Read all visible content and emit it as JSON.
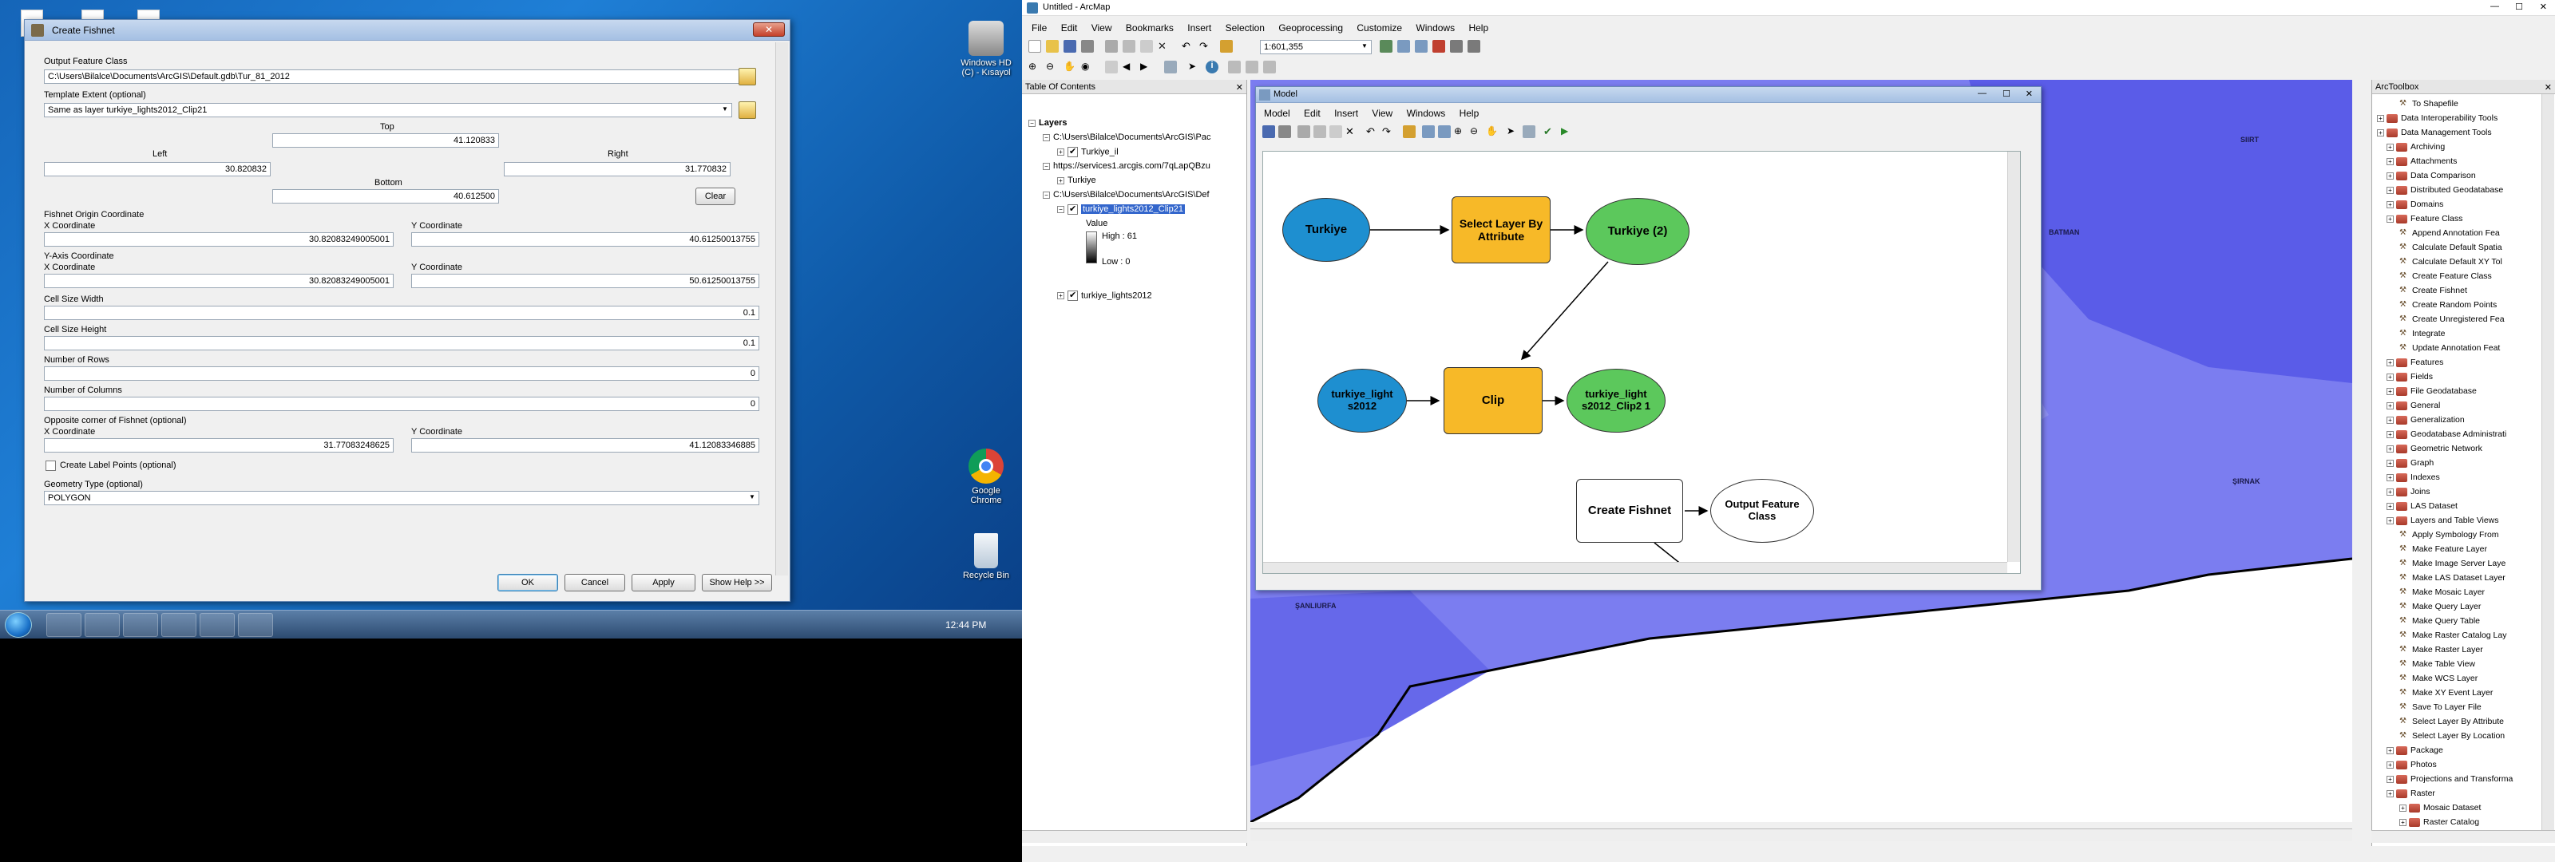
{
  "desktop": {
    "icons": [
      {
        "label": "Windows HD\n(C) - Kısayol"
      },
      {
        "label": "Google\nChrome"
      },
      {
        "label": "Recycle Bin"
      }
    ],
    "clock": "12:44 PM"
  },
  "dialog": {
    "title": "Create Fishnet",
    "output_label": "Output Feature Class",
    "output_value": "C:\\Users\\Bilalce\\Documents\\ArcGIS\\Default.gdb\\Tur_81_2012",
    "template_label": "Template Extent (optional)",
    "template_value": "Same as layer turkiye_lights2012_Clip21",
    "top_label": "Top",
    "top_value": "41.120833",
    "left_label": "Left",
    "left_value": "30.820832",
    "right_label": "Right",
    "right_value": "31.770832",
    "bottom_label": "Bottom",
    "bottom_value": "40.612500",
    "clear_label": "Clear",
    "origin_label": "Fishnet Origin Coordinate",
    "x_label": "X Coordinate",
    "y_label": "Y Coordinate",
    "origin_x": "30.82083249005001",
    "origin_y": "40.61250013755",
    "yaxis_label": "Y-Axis Coordinate",
    "yaxis_x": "30.82083249005001",
    "yaxis_y": "50.61250013755",
    "cellw_label": "Cell Size Width",
    "cellw_value": "0.1",
    "cellh_label": "Cell Size Height",
    "cellh_value": "0.1",
    "rows_label": "Number of Rows",
    "rows_value": "0",
    "cols_label": "Number of Columns",
    "cols_value": "0",
    "opposite_label": "Opposite corner of Fishnet (optional)",
    "opp_x": "31.77083248625",
    "opp_y": "41.12083346885",
    "labelpts_label": "Create Label Points (optional)",
    "geom_label": "Geometry Type (optional)",
    "geom_value": "POLYGON",
    "ok": "OK",
    "cancel": "Cancel",
    "apply": "Apply",
    "help": "Show Help >>"
  },
  "arcmap": {
    "title": "Untitled - ArcMap",
    "menus": [
      "File",
      "Edit",
      "View",
      "Bookmarks",
      "Insert",
      "Selection",
      "Geoprocessing",
      "Customize",
      "Windows",
      "Help"
    ],
    "scale": "1:601,355",
    "toc_title": "Table Of Contents",
    "toc": [
      "Layers",
      "C:\\Users\\Bilalce\\Documents\\ArcGIS\\Pac",
      "Turkiye_il",
      "https://services1.arcgis.com/7qLapQBzu",
      "Turkiye",
      "C:\\Users\\Bilalce\\Documents\\ArcGIS\\Def",
      "turkiye_lights2012_Clip21",
      "Value",
      "High : 61",
      "Low : 0",
      "turkiye_lights2012"
    ],
    "map_labels": [
      "SIIRT",
      "BATMAN",
      "ŞIRNAK",
      "ŞANLIURFA"
    ]
  },
  "model": {
    "title": "Model",
    "menus": [
      "Model",
      "Edit",
      "Insert",
      "View",
      "Windows",
      "Help"
    ],
    "nodes": {
      "turkiye": "Turkiye",
      "select": "Select Layer By Attribute",
      "turkiye2": "Turkiye (2)",
      "lights": "turkiye_light s2012",
      "clip": "Clip",
      "clipout": "turkiye_light s2012_Clip2 1",
      "fishnet": "Create Fishnet",
      "output": "Output Feature Class"
    }
  },
  "toolbox": {
    "title": "ArcToolbox",
    "items": [
      {
        "t": "To Shapefile",
        "lvl": 3,
        "k": "tool"
      },
      {
        "t": "Data Interoperability Tools",
        "lvl": 1,
        "k": "box"
      },
      {
        "t": "Data Management Tools",
        "lvl": 1,
        "k": "box"
      },
      {
        "t": "Archiving",
        "lvl": 2,
        "k": "box"
      },
      {
        "t": "Attachments",
        "lvl": 2,
        "k": "box"
      },
      {
        "t": "Data Comparison",
        "lvl": 2,
        "k": "box"
      },
      {
        "t": "Distributed Geodatabase",
        "lvl": 2,
        "k": "box"
      },
      {
        "t": "Domains",
        "lvl": 2,
        "k": "box"
      },
      {
        "t": "Feature Class",
        "lvl": 2,
        "k": "box"
      },
      {
        "t": "Append Annotation Fea",
        "lvl": 3,
        "k": "tool"
      },
      {
        "t": "Calculate Default Spatia",
        "lvl": 3,
        "k": "tool"
      },
      {
        "t": "Calculate Default XY Tol",
        "lvl": 3,
        "k": "tool"
      },
      {
        "t": "Create Feature Class",
        "lvl": 3,
        "k": "tool"
      },
      {
        "t": "Create Fishnet",
        "lvl": 3,
        "k": "tool"
      },
      {
        "t": "Create Random Points",
        "lvl": 3,
        "k": "tool"
      },
      {
        "t": "Create Unregistered Fea",
        "lvl": 3,
        "k": "tool"
      },
      {
        "t": "Integrate",
        "lvl": 3,
        "k": "tool"
      },
      {
        "t": "Update Annotation Feat",
        "lvl": 3,
        "k": "tool"
      },
      {
        "t": "Features",
        "lvl": 2,
        "k": "box"
      },
      {
        "t": "Fields",
        "lvl": 2,
        "k": "box"
      },
      {
        "t": "File Geodatabase",
        "lvl": 2,
        "k": "box"
      },
      {
        "t": "General",
        "lvl": 2,
        "k": "box"
      },
      {
        "t": "Generalization",
        "lvl": 2,
        "k": "box"
      },
      {
        "t": "Geodatabase Administrati",
        "lvl": 2,
        "k": "box"
      },
      {
        "t": "Geometric Network",
        "lvl": 2,
        "k": "box"
      },
      {
        "t": "Graph",
        "lvl": 2,
        "k": "box"
      },
      {
        "t": "Indexes",
        "lvl": 2,
        "k": "box"
      },
      {
        "t": "Joins",
        "lvl": 2,
        "k": "box"
      },
      {
        "t": "LAS Dataset",
        "lvl": 2,
        "k": "box"
      },
      {
        "t": "Layers and Table Views",
        "lvl": 2,
        "k": "box"
      },
      {
        "t": "Apply Symbology From",
        "lvl": 3,
        "k": "tool"
      },
      {
        "t": "Make Feature Layer",
        "lvl": 3,
        "k": "tool"
      },
      {
        "t": "Make Image Server Laye",
        "lvl": 3,
        "k": "tool"
      },
      {
        "t": "Make LAS Dataset Layer",
        "lvl": 3,
        "k": "tool"
      },
      {
        "t": "Make Mosaic Layer",
        "lvl": 3,
        "k": "tool"
      },
      {
        "t": "Make Query Layer",
        "lvl": 3,
        "k": "tool"
      },
      {
        "t": "Make Query Table",
        "lvl": 3,
        "k": "tool"
      },
      {
        "t": "Make Raster Catalog Lay",
        "lvl": 3,
        "k": "tool"
      },
      {
        "t": "Make Raster Layer",
        "lvl": 3,
        "k": "tool"
      },
      {
        "t": "Make Table View",
        "lvl": 3,
        "k": "tool"
      },
      {
        "t": "Make WCS Layer",
        "lvl": 3,
        "k": "tool"
      },
      {
        "t": "Make XY Event Layer",
        "lvl": 3,
        "k": "tool"
      },
      {
        "t": "Save To Layer File",
        "lvl": 3,
        "k": "tool"
      },
      {
        "t": "Select Layer By Attribute",
        "lvl": 3,
        "k": "tool"
      },
      {
        "t": "Select Layer By Location",
        "lvl": 3,
        "k": "tool"
      },
      {
        "t": "Package",
        "lvl": 2,
        "k": "box"
      },
      {
        "t": "Photos",
        "lvl": 2,
        "k": "box"
      },
      {
        "t": "Projections and Transforma",
        "lvl": 2,
        "k": "box"
      },
      {
        "t": "Raster",
        "lvl": 2,
        "k": "box"
      },
      {
        "t": "Mosaic Dataset",
        "lvl": 3,
        "k": "box"
      },
      {
        "t": "Raster Catalog",
        "lvl": 3,
        "k": "box"
      }
    ]
  }
}
